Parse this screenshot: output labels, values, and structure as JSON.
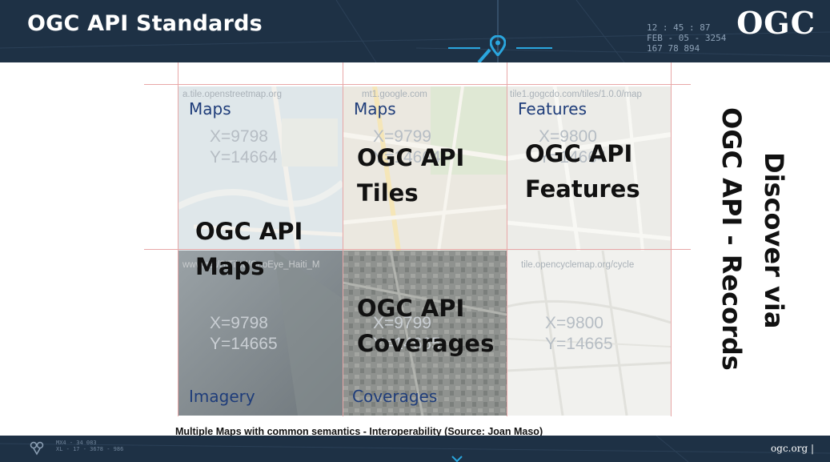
{
  "header": {
    "title": "OGC API Standards",
    "hud_lines": [
      "12 : 45 : 87",
      "FEB - 05 - 3254",
      "167    78    894"
    ],
    "logo_text": "OGC"
  },
  "grid": {
    "tiles": [
      {
        "ghost_url": "a.tile.openstreetmap.org",
        "coords": [
          "X=9798",
          "Y=14664"
        ],
        "label": "Maps"
      },
      {
        "ghost_url": "mt1.google.com",
        "coords": [
          "X=9799",
          "Y=14664"
        ],
        "label": "Maps"
      },
      {
        "ghost_url": "tile1.gogcdo.com/tiles/1.0.0/map",
        "coords": [
          "X=9800",
          "Y=14664"
        ],
        "label": "Features"
      },
      {
        "ghost_url": "www.cat/SITiled/GeoEye_Haiti_M",
        "coords": [
          "X=9798",
          "Y=14665"
        ],
        "label": "Imagery"
      },
      {
        "ghost_url": "",
        "coords": [
          "X=9799",
          "Y=14665"
        ],
        "label": "Coverages"
      },
      {
        "ghost_url": "tile.opencyclemap.org/cycle",
        "coords": [
          "X=9800",
          "Y=14665"
        ],
        "label": ""
      }
    ],
    "standards": {
      "maps": [
        "OGC API",
        "Maps"
      ],
      "tiles": [
        "OGC API",
        "Tiles"
      ],
      "features": [
        "OGC API",
        "Features"
      ],
      "coverages": [
        "OGC API",
        "Coverages"
      ]
    },
    "caption": "Multiple Maps with common semantics - Interoperability (Source: Joan Maso)"
  },
  "side_text": {
    "line1": "Discover via",
    "line2": "OGC API - Records"
  },
  "footer": {
    "micro_lines": [
      "MX4 - 34    083",
      "XL - 17 - 3678 - 986"
    ],
    "link": "ogc.org  |"
  },
  "colors": {
    "banner": "#1e3145",
    "accent_cyan": "#2aa6de",
    "tile_label": "#1f3d7a",
    "gridline": "#e8a7a7"
  }
}
